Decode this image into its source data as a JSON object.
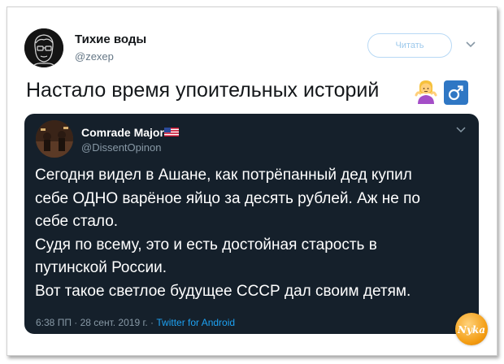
{
  "tweet": {
    "author_name": "Тихие воды",
    "author_handle": "@zexep",
    "follow_label": "Читать",
    "text": "Настало время упоительных историй"
  },
  "quoted_tweet": {
    "author_name": "Comrade Major",
    "author_handle": "@DissentOpinon",
    "lines": [
      "Сегодня видел в Ашане, как потрёпанный дед купил",
      "себе ОДНО варёное яйцо за десять рублей. Аж не по",
      "себе стало.",
      "Судя по всему, это и есть достойная старость в",
      "путинской России.",
      "Вот такое светлое будущее СССР дал своим детям."
    ],
    "timestamp": "6:38 ПП · 28 сент. 2019 г. · ",
    "source": "Twitter for Android"
  },
  "watermark_text": "Nyka",
  "colors": {
    "link": "#1da1f2",
    "quote_bg": "#15202b",
    "secondary_text": "#8899a6"
  },
  "icons": [
    "caret-down-icon",
    "person-shrugging-emoji-icon",
    "male-sign-icon",
    "us-flag-icon"
  ]
}
